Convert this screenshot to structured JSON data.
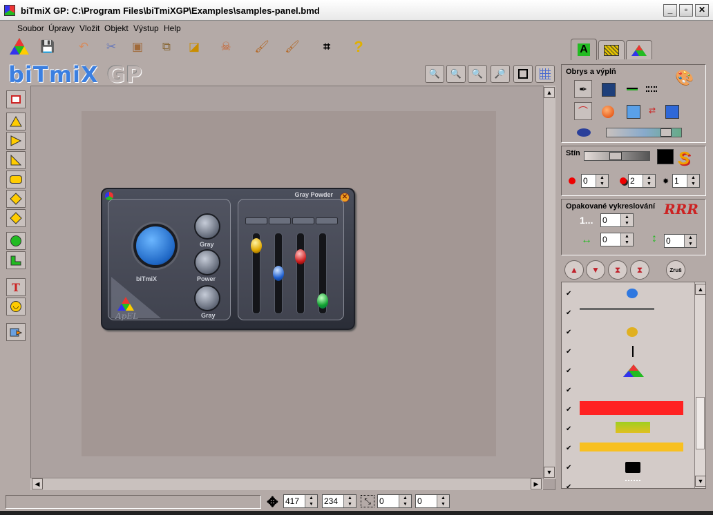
{
  "window": {
    "title": "biTmiX GP: C:\\Program Files\\biTmiXGP\\Examples\\samples-panel.bmd",
    "controls": [
      "minimize",
      "maximize",
      "close"
    ]
  },
  "menu": [
    "Soubor",
    "Úpravy",
    "Vložit",
    "Objekt",
    "Výstup",
    "Help"
  ],
  "logo": {
    "main": "biTmiX",
    "suffix": " GP"
  },
  "toolbar_icons": [
    "app-logo-icon",
    "save-icon",
    "undo-icon",
    "cut-icon",
    "paste-icon",
    "copy-icon",
    "duplicate-icon",
    "delete-icon",
    "brush-icon",
    "brush-alt-icon",
    "crop-icon",
    "help-icon"
  ],
  "zoom_buttons": [
    "zoom-fit-icon",
    "zoom-out-icon",
    "zoom-in-icon",
    "zoom-select-icon",
    "selection-frame-icon",
    "grid-icon"
  ],
  "left_tools": [
    "rectangle-tool",
    "triangle-tool",
    "right-arrow-tool",
    "right-triangle-tool",
    "rounded-rect-tool",
    "diamond-tool",
    "diamond-alt-tool",
    "circle-tool",
    "polygon-tool",
    "text-tool",
    "smiley-tool",
    "image-tool"
  ],
  "panel_graphic": {
    "title": "Gray Powder",
    "knob_label": "biTmiX",
    "small_labels": [
      "Gray",
      "Power",
      "Gray"
    ],
    "brand": "ApEL"
  },
  "right_panel": {
    "tabs": [
      "shapes-tab",
      "fill-tab",
      "color-tab"
    ],
    "outline_fill": {
      "heading": "Obrys a výplň"
    },
    "shadow": {
      "heading": "Stín",
      "values": [
        "0",
        "2",
        "1"
      ]
    },
    "repeat": {
      "heading": "Opakované vykreslování",
      "logo": "RRR",
      "count_label": "1...",
      "count": "0",
      "horizontal": "0",
      "vertical": "0"
    },
    "order_buttons": [
      "move-up",
      "move-down",
      "move-top",
      "move-bottom",
      "reset"
    ],
    "order_reset_label": "Zruš"
  },
  "layers": [
    {
      "checked": true,
      "preview": "blue-circle"
    },
    {
      "checked": true,
      "preview": "gray-line"
    },
    {
      "checked": true,
      "preview": "yellow-circle"
    },
    {
      "checked": true,
      "preview": "black-bar"
    },
    {
      "checked": true,
      "preview": "logo"
    },
    {
      "checked": true,
      "preview": "empty"
    },
    {
      "checked": true,
      "preview": "red-rect"
    },
    {
      "checked": true,
      "preview": "green-rect"
    },
    {
      "checked": true,
      "preview": "yellow-rect"
    },
    {
      "checked": true,
      "preview": "black-rect"
    },
    {
      "checked": true,
      "preview": "dots"
    }
  ],
  "statusbar": {
    "x": "417",
    "y": "234",
    "w": "0",
    "h": "0"
  },
  "colors": {
    "background": "#b4aaa7",
    "canvas": "#a39794",
    "accent_blue": "#3b7fe0",
    "fill_blue": "#1e3f7a"
  }
}
